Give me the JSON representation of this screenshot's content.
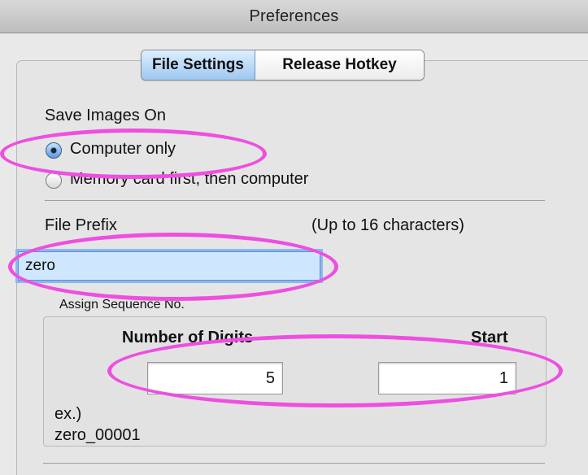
{
  "window": {
    "title": "Preferences"
  },
  "tabs": [
    {
      "label": "File Settings",
      "active": true
    },
    {
      "label": "Release Hotkey",
      "active": false
    }
  ],
  "save_images": {
    "heading": "Save Images On",
    "options": [
      {
        "label": "Computer only",
        "selected": true
      },
      {
        "label": "Memory card first, then computer",
        "selected": false
      }
    ]
  },
  "file_prefix": {
    "label": "File Prefix",
    "hint": "(Up to 16 characters)",
    "value": "zero"
  },
  "sequence": {
    "heading": "Assign Sequence No.",
    "digits_label": "Number of Digits",
    "digits_value": "5",
    "start_label": "Start",
    "start_value": "1",
    "example_label": "ex.)",
    "example_value": "zero_00001"
  },
  "annotation_color": "#ee4fe0"
}
